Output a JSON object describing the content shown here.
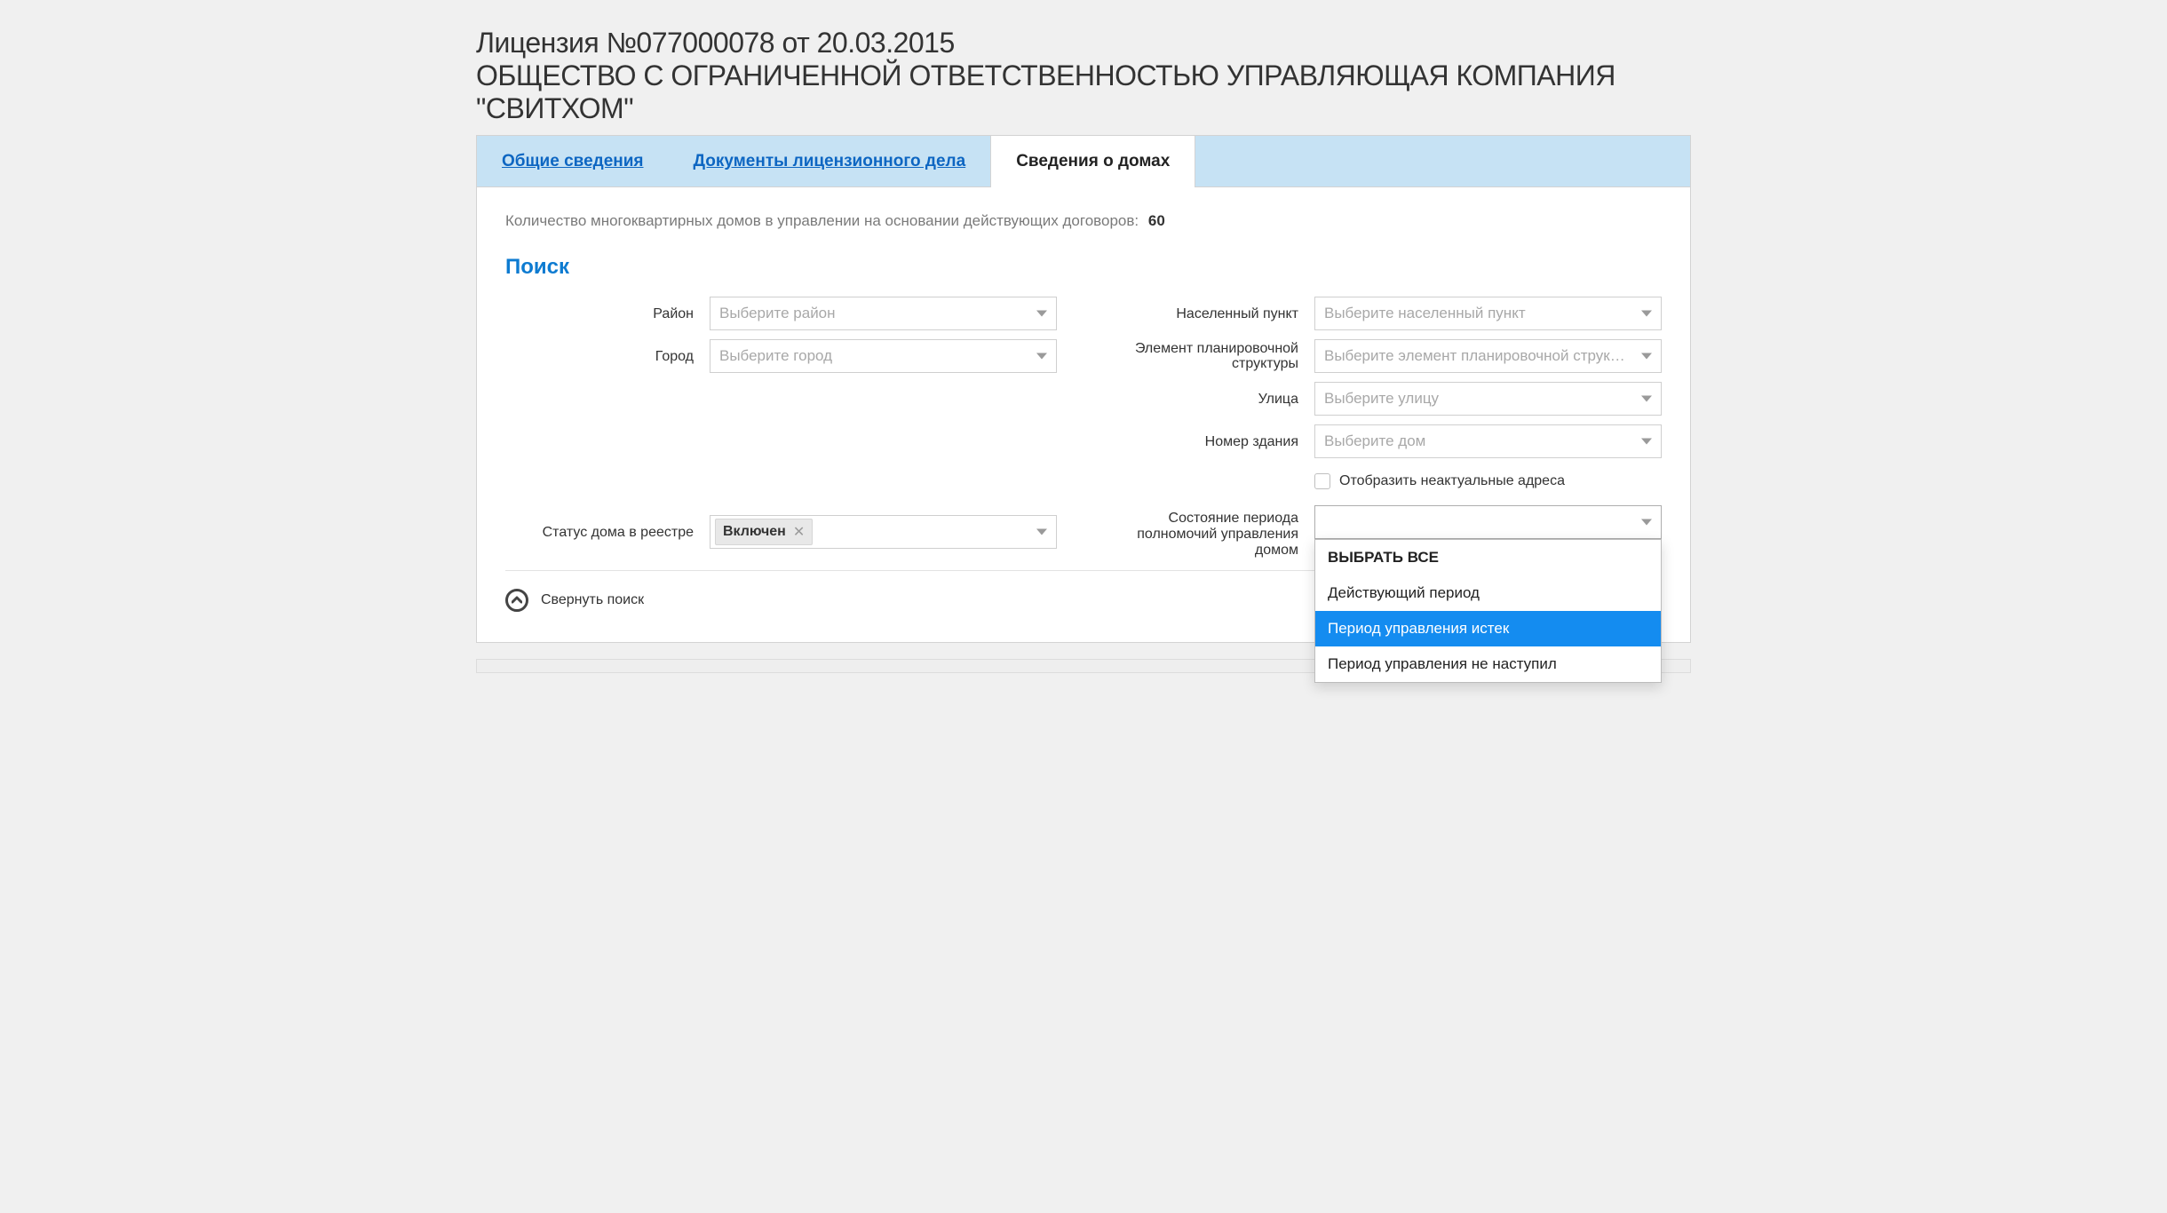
{
  "heading": {
    "line1": "Лицензия №077000078 от 20.03.2015",
    "line2": "ОБЩЕСТВО С ОГРАНИЧЕННОЙ ОТВЕТСТВЕННОСТЬЮ УПРАВЛЯЮЩАЯ КОМПАНИЯ \"СВИТХОМ\""
  },
  "tabs": {
    "general": "Общие сведения",
    "docs": "Документы лицензионного дела",
    "houses": "Сведения о домах"
  },
  "count": {
    "label": "Количество многоквартирных домов в управлении на основании действующих договоров:",
    "value": "60"
  },
  "search": {
    "title": "Поиск",
    "labels": {
      "district": "Район",
      "city": "Город",
      "locality": "Населенный пункт",
      "planning": "Элемент планировочной структуры",
      "street": "Улица",
      "building": "Номер здания",
      "show_irrelevant": "Отобразить неактуальные адреса",
      "status": "Статус дома в реестре",
      "period_state": "Состояние периода полномочий управления домом"
    },
    "placeholders": {
      "district": "Выберите район",
      "city": "Выберите город",
      "locality": "Выберите населенный пункт",
      "planning": "Выберите элемент планировочной струк…",
      "street": "Выберите улицу",
      "building": "Выберите дом"
    },
    "status_chip": "Включен",
    "period_options": {
      "select_all": "ВЫБРАТЬ ВСЕ",
      "active": "Действующий период",
      "expired": "Период управления истек",
      "not_started": "Период управления не наступил"
    }
  },
  "collapse_label": "Свернуть поиск"
}
